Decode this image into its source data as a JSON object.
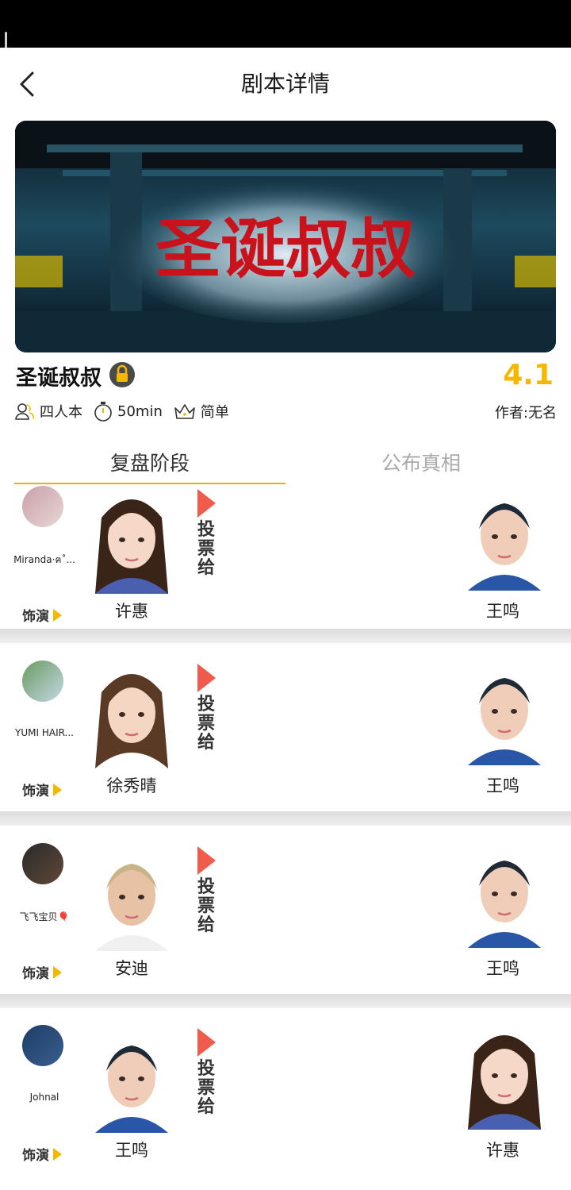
{
  "header": {
    "title": "剧本详情"
  },
  "script": {
    "title": "圣诞叔叔",
    "banner_title": "圣诞叔叔",
    "rating": "4.1",
    "players": "四人本",
    "duration": "50min",
    "difficulty": "简单",
    "author": "作者:无名"
  },
  "tabs": [
    {
      "label": "复盘阶段"
    },
    {
      "label": "公布真相"
    }
  ],
  "labels": {
    "plays": "饰演",
    "vote_to": "投票给"
  },
  "cards": [
    {
      "player": "Miranda·ฅ˚...",
      "character": "许惠",
      "voted_for": "王鸣"
    },
    {
      "player": "YUMI HAIR...",
      "character": "徐秀晴",
      "voted_for": "王鸣"
    },
    {
      "player": "飞飞宝贝🎈",
      "character": "安迪",
      "voted_for": "王鸣"
    },
    {
      "player": "Johnal",
      "character": "王鸣",
      "voted_for": "许惠"
    }
  ]
}
